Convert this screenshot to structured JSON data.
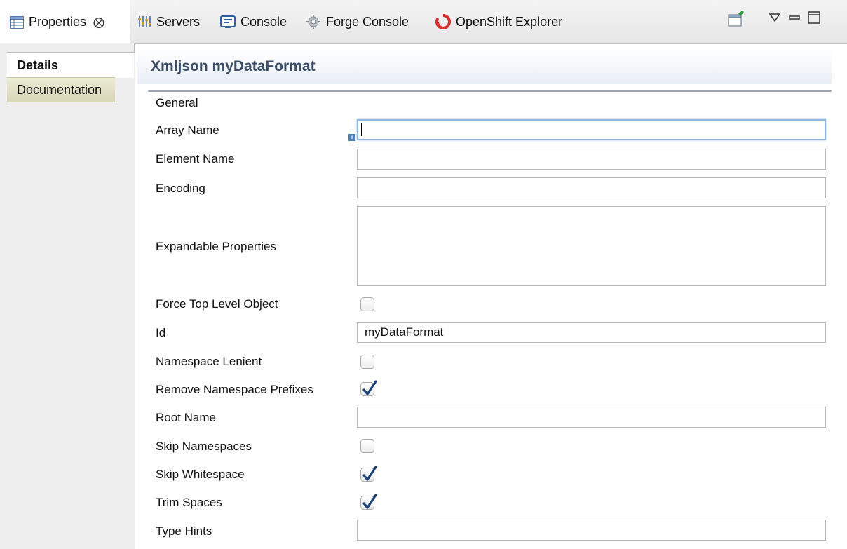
{
  "tabs": [
    {
      "label": "Properties",
      "icon": "properties-table-icon",
      "active": true
    },
    {
      "label": "Servers",
      "icon": "servers-icon",
      "active": false
    },
    {
      "label": "Console",
      "icon": "console-icon",
      "active": false
    },
    {
      "label": "Forge Console",
      "icon": "forge-icon",
      "active": false
    },
    {
      "label": "OpenShift Explorer",
      "icon": "openshift-icon",
      "active": false
    }
  ],
  "nav": [
    {
      "label": "Details",
      "active": true
    },
    {
      "label": "Documentation",
      "active": false
    }
  ],
  "header": {
    "title": "Xmljson myDataFormat"
  },
  "section": {
    "title": "General"
  },
  "fields": {
    "array_name": {
      "label": "Array Name",
      "value": ""
    },
    "element_name": {
      "label": "Element Name",
      "value": ""
    },
    "encoding": {
      "label": "Encoding",
      "value": ""
    },
    "expandable_properties": {
      "label": "Expandable Properties",
      "value": ""
    },
    "force_top_level_object": {
      "label": "Force Top Level Object",
      "checked": false
    },
    "id": {
      "label": "Id",
      "value": "myDataFormat"
    },
    "namespace_lenient": {
      "label": "Namespace Lenient",
      "checked": false
    },
    "remove_namespace_prefixes": {
      "label": "Remove Namespace Prefixes",
      "checked": true
    },
    "root_name": {
      "label": "Root Name",
      "value": ""
    },
    "skip_namespaces": {
      "label": "Skip Namespaces",
      "checked": false
    },
    "skip_whitespace": {
      "label": "Skip Whitespace",
      "checked": true
    },
    "trim_spaces": {
      "label": "Trim Spaces",
      "checked": true
    },
    "type_hints": {
      "label": "Type Hints",
      "value": ""
    }
  },
  "colors": {
    "header_text": "#3c4e67",
    "openshift_red": "#d32f2f",
    "focus_ring": "#8fb7de"
  }
}
